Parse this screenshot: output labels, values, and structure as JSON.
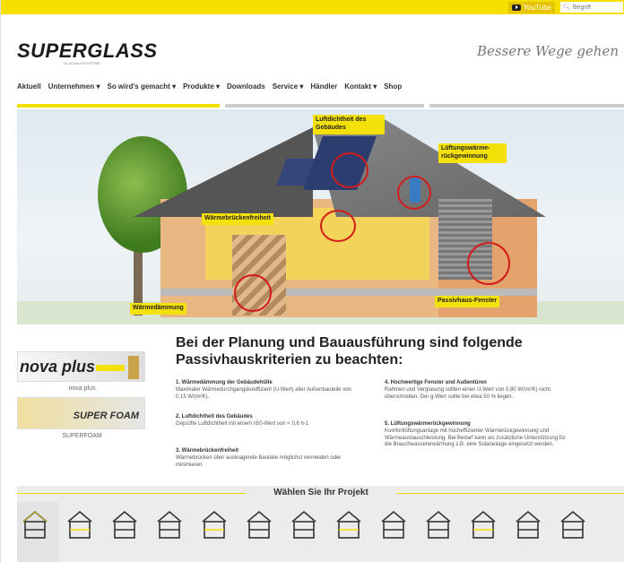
{
  "topbar": {
    "youtube_label": "YouTube",
    "search_placeholder": "Begriff"
  },
  "header": {
    "logo": "SUPERGLASS",
    "logo_sub": "GLASHAUSSYSTEME",
    "slogan": "Bessere Wege gehen"
  },
  "nav": {
    "items": [
      "Aktuell",
      "Unternehmen ▾",
      "So wird's gemacht ▾",
      "Produkte ▾",
      "Downloads",
      "Service ▾",
      "Händler",
      "Kontakt ▾",
      "Shop"
    ]
  },
  "hero": {
    "labels": {
      "luftdichtheit": "Luftdichtheit des Gebäudes",
      "lueftung": "Lüftungswärme-rückgewinnung",
      "waermebruecken": "Wärmebrückenfreiheit",
      "passivhaus_fenster": "Passivhaus-Fenster",
      "waermedaemmung": "Wärmedämmung"
    }
  },
  "products": [
    {
      "logo": "nova plus",
      "name": "nova plus"
    },
    {
      "logo": "SUPER FOAM",
      "name": "SUPERFOAM"
    }
  ],
  "main": {
    "headline": "Bei der Planung und Bauausführung sind folgende Passivhauskriterien zu beachten:",
    "criteria": [
      {
        "title": "1. Wärmedämmung der Gebäudehülle",
        "text": "Maximaler Wärmedurchgangskoeffizient (U-Wert) aller Außenbauteile von 0,15 W/(m²K)."
      },
      {
        "title": "2. Luftdichtheit des Gebäudes",
        "text": "Geprüfte Luftdichtheit mit einem n50-Wert von < 0,6 h-1"
      },
      {
        "title": "3. Wärmebrückenfreiheit",
        "text": "Wärmebrücken über auskragende Bauteile möglichst vermeiden oder minimieren."
      },
      {
        "title": "4. Hochwertige Fenster und Außentüren",
        "text": "Rahmen und Verglasung sollten einen U-Wert von 0,80 W/(m²K) nicht überschreiten. Der g-Wert sollte bei etwa 50 % liegen."
      },
      {
        "title": "5. Lüftungswärmerückgewinnung",
        "text": "Komfortlüftungsanlage mit hocheffizienter Wärmerückgewinnung und Wärmeaustauschleistung. Bei Bedarf kann als zusätzliche Unterstützung für die Brauchwassererwärmung z.B. eine Solaranlage eingesetzt werden."
      }
    ]
  },
  "projects": {
    "title": "Wählen Sie Ihr Projekt",
    "count": 13
  },
  "colors": {
    "brand_yellow": "#f5df00",
    "accent_red": "#d21c1c"
  }
}
